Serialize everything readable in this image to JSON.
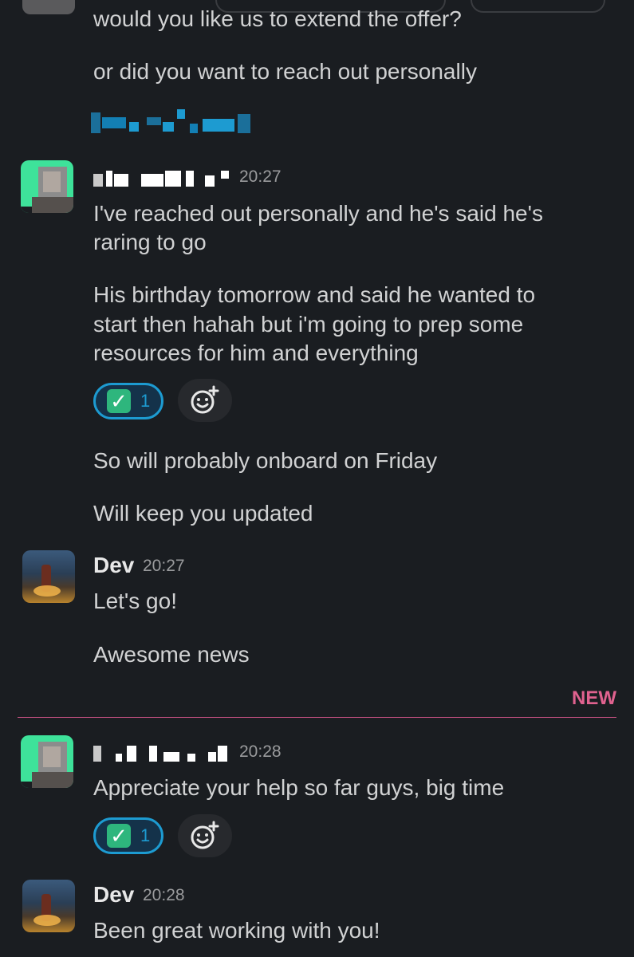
{
  "messages": {
    "prev_1": "would you like us to extend the offer?",
    "prev_2": "or did you want to reach out personally",
    "m1_time": "20:27",
    "m1_line1": "I've reached out personally and he's said he's",
    "m1_line2": "raring to go",
    "m1_p2_line1": "His birthday tomorrow and said he wanted to",
    "m1_p2_line2": "start then hahah but i'm going to prep some",
    "m1_p2_line3": "resources for him and everything",
    "m1_p3": "So will probably onboard on Friday",
    "m1_p4": "Will keep you updated",
    "dev1_name": "Dev",
    "dev1_time": "20:27",
    "dev1_line1": "Let's go!",
    "dev1_line2": "Awesome news",
    "new_label": "NEW",
    "m2_time": "20:28",
    "m2_line1": "Appreciate your help so far guys, big time",
    "dev2_name": "Dev",
    "dev2_time": "20:28",
    "dev2_line1": "Been great working with you!"
  },
  "reactions": {
    "r1_emoji": "✓",
    "r1_count": "1",
    "r2_emoji": "✓",
    "r2_count": "1"
  },
  "icons": {
    "reaction_emoji": "white-check-mark-icon",
    "add_reaction": "add-reaction-icon",
    "avatar_user": "pixelated-avatar-icon",
    "avatar_dev": "dev-avatar-photo"
  },
  "colors": {
    "background": "#1a1d21",
    "reaction_border": "#1d9bd1",
    "check_green": "#2eb67d",
    "new_divider": "#e05a91",
    "avatar_green": "#3ee29a"
  }
}
